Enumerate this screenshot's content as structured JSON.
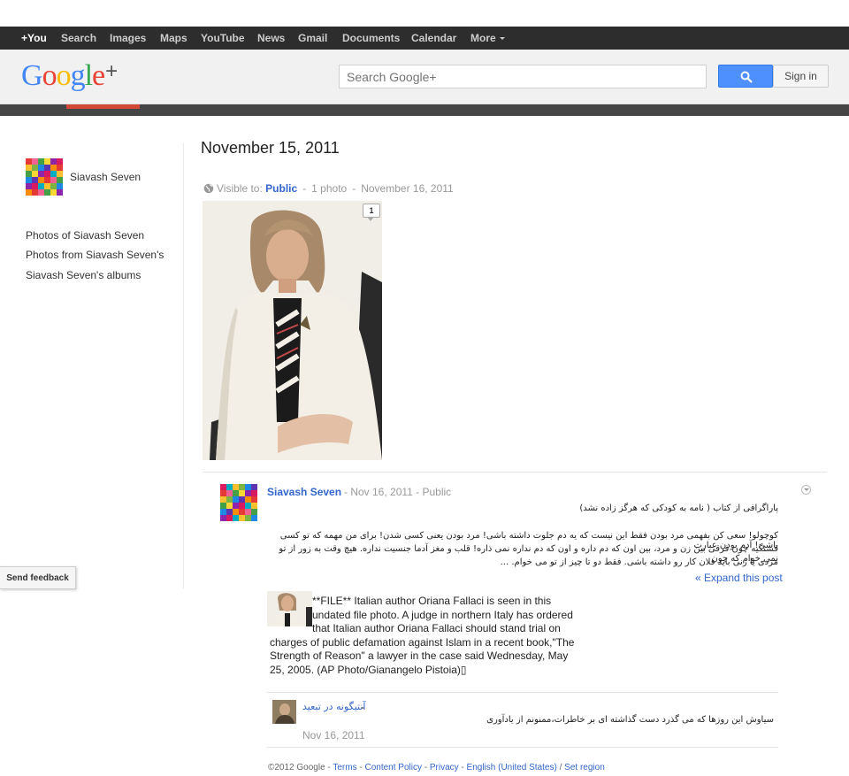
{
  "topbar": {
    "items": [
      "+You",
      "Search",
      "Images",
      "Maps",
      "YouTube",
      "News",
      "Gmail",
      "Documents",
      "Calendar",
      "More"
    ]
  },
  "header": {
    "logo_text": "Google",
    "logo_plus": "+",
    "search_placeholder": "Search Google+",
    "signin_label": "Sign in"
  },
  "sidebar": {
    "profile_name": "Siavash Seven",
    "links": [
      "Photos of Siavash Seven",
      "Photos from Siavash Seven's posts",
      "Siavash Seven's albums"
    ]
  },
  "album": {
    "title": "November 15, 2011",
    "visible_label": "Visible to:",
    "visibility": "Public",
    "photo_count": "1 photo",
    "date": "November 16, 2011",
    "comment_count": "1"
  },
  "post": {
    "author": "Siavash Seven",
    "meta": "-  Nov 16, 2011  -  Public",
    "heading_rtl": "پاراگرافی از کتاب ( نامه به کودکی که هرگز زاده نشد)",
    "body_rtl": [
      "کوچولو! سعی کن بفهمی مرد بودن فقط این نیست که یه دم جلوت داشته باشی! مرد بودن یعنی کسی شدن! برای من مهمه که تو کسی باشی! آدم بودن عبارت",
      "قشنگیه چون فرقی بین زن و مرد، بین اون که دم داره و اون که دم نداره نمی ذاره! قلب و مغز آدما جنسیت نداره. هیچ وقت به زور از تو نمی خوام که چون",
      "مردی یا زنی باید فلان کار رو داشته باشی. فقط دو تا چیز از تو می خوام.  ..."
    ],
    "expand_label": "« Expand this post",
    "caption": "**FILE** Italian author Oriana Fallaci is seen in this undated file photo. A judge in northern Italy has ordered that Italian author Oriana Fallaci should stand trial on charges of public defamation against Islam in a recent book,\"The Strength of Reason\" a lawyer in the case said Wednesday, May 25, 2005. (AP Photo/Gianangelo Pistoia)▯"
  },
  "comment": {
    "author": "آنتیگونه در تبعید",
    "dash": "-",
    "text": "سیاوش این روزها که می گذرد دست گذاشته ای بر خاطرات،ممنونم از یادآوری",
    "date": "Nov 16, 2011"
  },
  "footer": {
    "copyright": "©2012 Google",
    "links": [
      "Terms",
      "Content Policy",
      "Privacy",
      "English (United States)",
      "Set region"
    ]
  },
  "feedback_label": "Send feedback",
  "colors": {
    "topbar_bg": "#2d2d2d",
    "header_bg": "#f1f1f1",
    "link_blue": "#3366cc",
    "search_button": "#4d90fe",
    "accent_red": "#d34836"
  },
  "icons": [
    "globe-icon",
    "search-icon",
    "comment-bubble-icon",
    "post-menu-chevron-icon"
  ]
}
